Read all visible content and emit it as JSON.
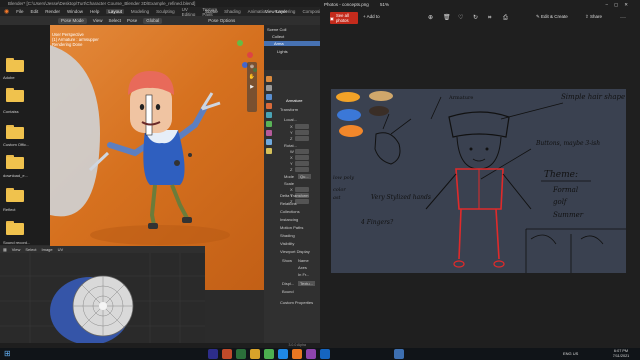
{
  "blender": {
    "title": "Blender* [C:\\Users\\Jesse\\Desktop\\Turt\\Character Course_Blender 3D\\Example_refined.blend]",
    "menu": [
      "File",
      "Edit",
      "Render",
      "Window",
      "Help"
    ],
    "workspaces": [
      "Layout",
      "Modeling",
      "Sculpting",
      "UV Editing",
      "Texture Paint",
      "Shading",
      "Animation",
      "Rendering",
      "Compositing",
      "Geometry Nodes",
      "Scripting"
    ],
    "active_workspace": "Layout",
    "scene": "Scene",
    "view_layer": "View Layer",
    "header": {
      "mode": "Pose Mode",
      "view": "View",
      "select": "Select",
      "pose": "Pose",
      "global": "Global",
      "pose_options": "Pose Options"
    },
    "viewport_info": [
      "User Perspective",
      "(1) Armature : armsupper",
      "Rendering Done"
    ],
    "sidebar_folders": [
      "Adobe",
      "Contaiss",
      "Custom Offic...",
      "download_e...",
      "Reflect",
      "Sound record..."
    ],
    "outliner": {
      "rows": [
        "Scene Coll",
        "Collect",
        "Arma",
        "Lights"
      ]
    },
    "properties": {
      "object": "Armature",
      "sections": [
        "Transform",
        "Delta Transform",
        "Relations",
        "Collections",
        "Instancing",
        "Motion Paths",
        "Shading",
        "Visibility",
        "Viewport Display",
        "Custom Properties"
      ],
      "transform_labels": [
        "Local...",
        "X",
        "Y",
        "Z",
        "Rotat...",
        "W",
        "X",
        "Y",
        "Z",
        "Mode",
        "Scale",
        "X",
        "Y",
        "Z"
      ],
      "mode_value": "Qu...",
      "viewport_display": {
        "show": "Show",
        "options": [
          "Name",
          "Axes",
          "In Fr..."
        ],
        "display_as": "Displ...",
        "display_value": "Textu...",
        "bounds": "Bound"
      }
    },
    "uv_header": [
      "View",
      "Select",
      "Image",
      "UV"
    ],
    "version": "3.0.0 Alpha"
  },
  "photos": {
    "title": "Photos - concepts.png",
    "zoom": "51%",
    "see_all": "See all photos",
    "add_to": "Add to",
    "edit_create": "Edit & Create",
    "share": "Share",
    "sketch_notes": [
      "Simple hair shape",
      "Armature",
      "Buttons, maybe 3-ish",
      "Theme:",
      "Formal",
      "golf",
      "Summer",
      "Very Stylized hands",
      "4 Fingers?",
      "low poly",
      "color",
      "ast"
    ]
  },
  "taskbar": {
    "lang": "ENG",
    "region": "US",
    "time": "6:07 PM",
    "date": "7/11/2021"
  },
  "colors": {
    "see_all_bg": "#c42b1c",
    "selection": "#4772b3",
    "viewport_orange": "#d6711f",
    "canvas_bg": "#3a4150",
    "red_sketch": "#e02a2a"
  }
}
